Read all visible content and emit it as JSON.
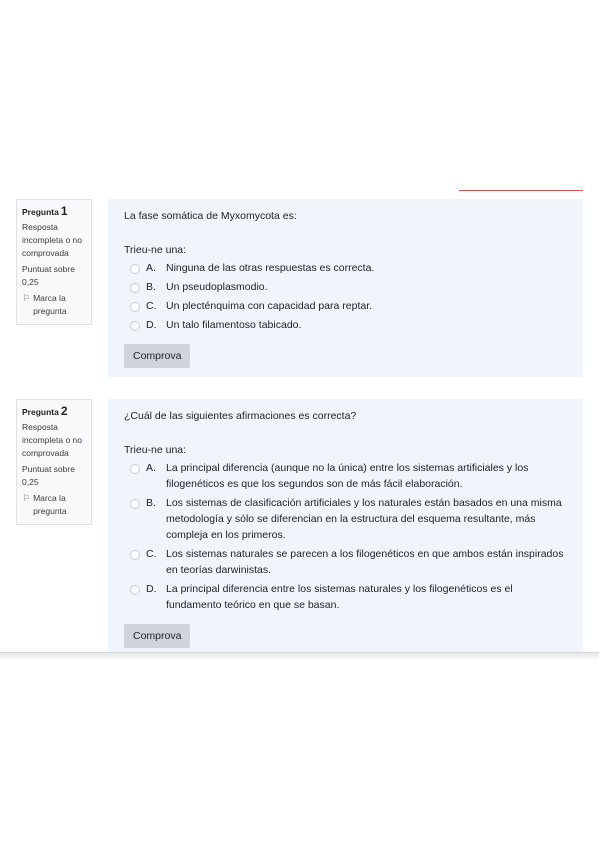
{
  "questions": [
    {
      "label": "Pregunta",
      "number": "1",
      "status": "Resposta incompleta o no comprovada",
      "points": "Puntuat sobre 0,25",
      "flag_label": "Marca la pregunta",
      "flag_icon": "flag-icon",
      "text": "La fase somática de Myxomycota es:",
      "prompt": "Trieu-ne una:",
      "answers": [
        {
          "letter": "A.",
          "text": "Ninguna de las otras respuestas es correcta."
        },
        {
          "letter": "B.",
          "text": "Un pseudoplasmodio."
        },
        {
          "letter": "C.",
          "text": "Un plecténquima con capacidad para reptar."
        },
        {
          "letter": "D.",
          "text": "Un talo filamentoso tabicado."
        }
      ],
      "button": "Comprova"
    },
    {
      "label": "Pregunta",
      "number": "2",
      "status": "Resposta incompleta o no comprovada",
      "points": "Puntuat sobre 0,25",
      "flag_label": "Marca la pregunta",
      "flag_icon": "flag-icon",
      "text": "¿Cuál de las siguientes afirmaciones es correcta?",
      "prompt": "Trieu-ne una:",
      "answers": [
        {
          "letter": "A.",
          "text": "La principal diferencia (aunque no la única) entre los sistemas artificiales y los filogenéticos es que los segundos son de más fácil elaboración."
        },
        {
          "letter": "B.",
          "text": "Los sistemas de clasificación artificiales y los naturales están basados en una misma metodología y sólo se diferencian en la estructura del esquema resultante, más compleja en los primeros."
        },
        {
          "letter": "C.",
          "text": "Los sistemas naturales se parecen a los filogenéticos en que ambos están inspirados en teorías darwinistas."
        },
        {
          "letter": "D.",
          "text": "La principal diferencia entre los sistemas naturales y los filogenéticos es el fundamento teórico en que se basan."
        }
      ],
      "button": "Comprova"
    }
  ]
}
